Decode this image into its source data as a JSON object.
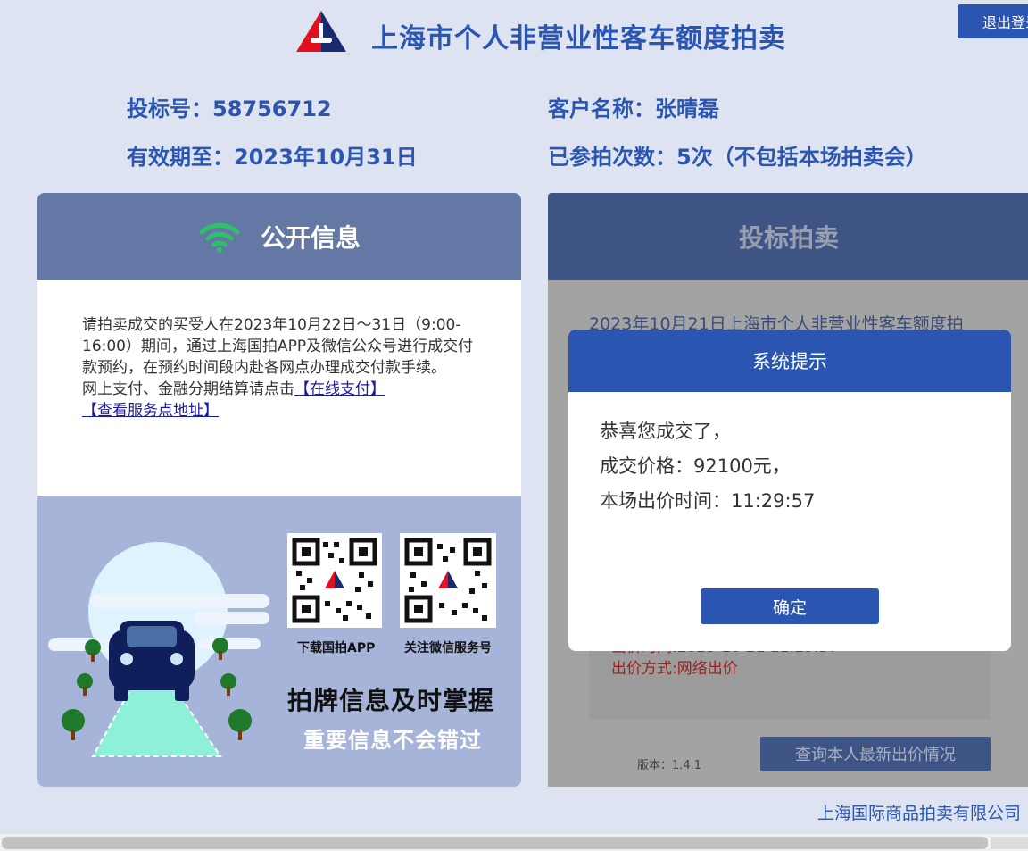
{
  "header": {
    "title": "上海市个人非营业性客车额度拍卖",
    "logout_label": "退出登录"
  },
  "bidder": {
    "bid_number": "投标号：58756712",
    "customer_name": "客户名称：张晴磊",
    "valid_until": "有效期至：2023年10月31日",
    "participation_count": "已参拍次数：5次（不包括本场拍卖会）"
  },
  "public_info": {
    "title": "公开信息",
    "notice": "请拍卖成交的买受人在2023年10月22日～31日（9:00-16:00）期间，通过上海国拍APP及微信公众号进行成交付款预约，在预约时间段内赴各网点办理成交付款手续。",
    "payment_prompt": "网上支付、金融分期结算请点击",
    "online_pay_link": "【在线支付】",
    "service_point_link": "【查看服务点地址】",
    "qr_app_caption": "下载国拍APP",
    "qr_wechat_caption": "关注微信服务号",
    "slogan_main": "拍牌信息及时掌握",
    "slogan_sub": "重要信息不会错过"
  },
  "auction": {
    "title": "投标拍卖",
    "auction_text": "2023年10月21日上海市个人非营业性客车额度拍",
    "bid_time": "出价时间:2023-10-21 11:29:57",
    "bid_method": "出价方式:网络出价",
    "version": "版本：1.4.1",
    "query_button": "查询本人最新出价情况"
  },
  "modal": {
    "title": "系统提示",
    "line1": "恭喜您成交了，",
    "line2": "成交价格：92100元，",
    "line3": "本场出价时间：11:29:57",
    "confirm_label": "确定"
  },
  "footer": {
    "company": "上海国际商品拍卖有限公司"
  },
  "colors": {
    "brand_blue": "#2a56b2",
    "page_bg": "#dde3f0",
    "panel_header_left": "#6478a6",
    "panel_header_right": "#3e5485",
    "wifi_green": "#2fc06a",
    "bid_red": "#a51e1e"
  },
  "icons": {
    "logo": "auction-logo",
    "wifi": "wifi-icon",
    "qr": "qr-code-icon",
    "car": "car-illustration"
  }
}
